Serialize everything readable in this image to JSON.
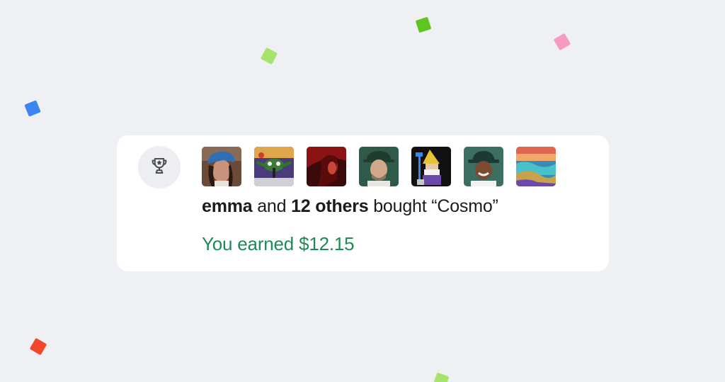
{
  "notification": {
    "buyer_name": "emma",
    "connector_and": "and",
    "others_count": "12 others",
    "verb": "bought",
    "product_title": "“Cosmo”",
    "earnings_text": "You earned $12.15",
    "icon": "trophy-icon",
    "avatars": [
      {
        "name": "buyer-avatar-1",
        "accent": "#2f6fb5"
      },
      {
        "name": "buyer-avatar-2",
        "accent": "#3b7a3a"
      },
      {
        "name": "buyer-avatar-3",
        "accent": "#b11f1f"
      },
      {
        "name": "buyer-avatar-4",
        "accent": "#2f5a48"
      },
      {
        "name": "buyer-avatar-5",
        "accent": "#e8c236"
      },
      {
        "name": "buyer-avatar-6",
        "accent": "#2b5a4e"
      },
      {
        "name": "buyer-avatar-7",
        "accent": "#e0664f"
      }
    ]
  },
  "colors": {
    "background": "#eff0f4",
    "card": "#ffffff",
    "earnings_green": "#1e8a55",
    "confetti": [
      "#5fc621",
      "#a6e36a",
      "#f59bc2",
      "#3b86f0",
      "#f2472a",
      "#a6e36a"
    ]
  }
}
